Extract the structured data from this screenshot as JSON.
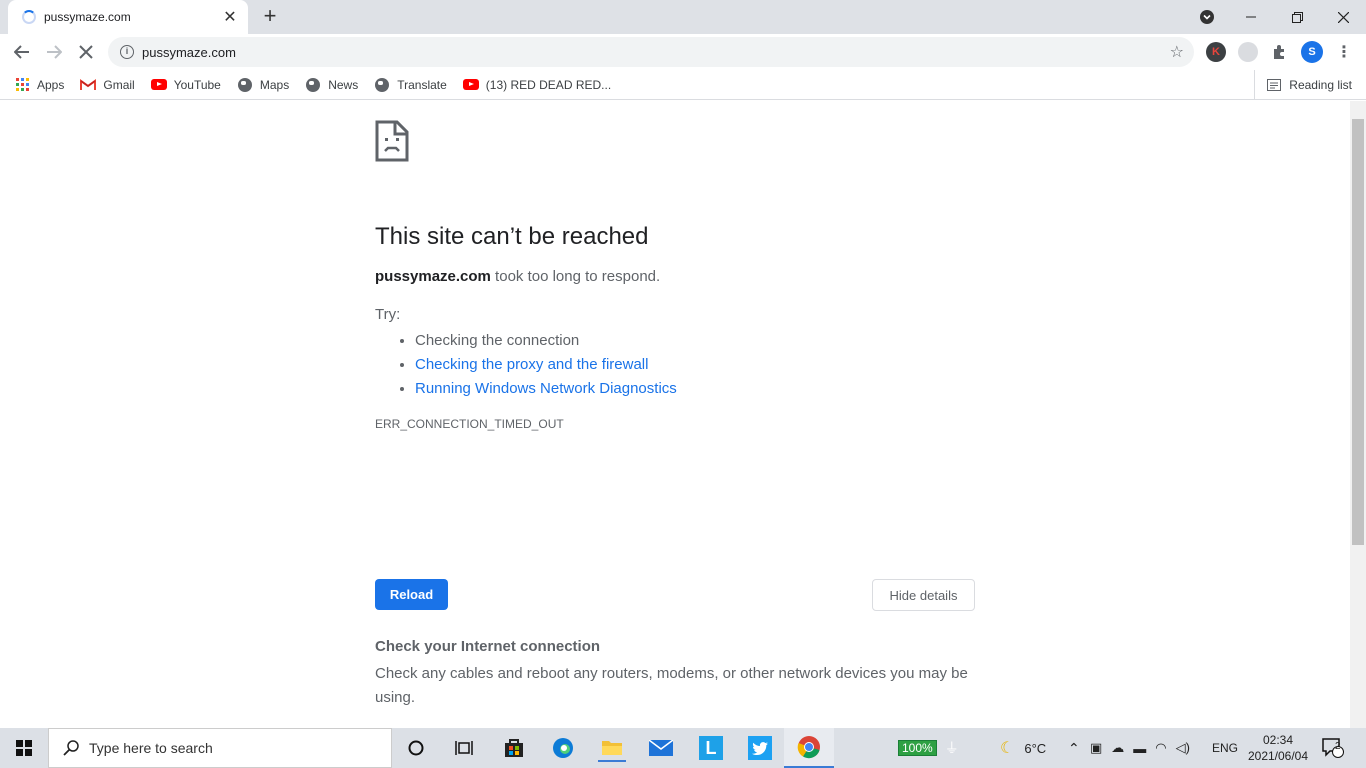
{
  "browser": {
    "tab_title": "pussymaze.com",
    "url": "pussymaze.com",
    "profile_initial": "S",
    "extension_initial": "K"
  },
  "bookmarks": [
    {
      "label": "Apps",
      "icon": "apps-grid-icon"
    },
    {
      "label": "Gmail",
      "icon": "gmail-icon"
    },
    {
      "label": "YouTube",
      "icon": "youtube-icon"
    },
    {
      "label": "Maps",
      "icon": "globe-icon"
    },
    {
      "label": "News",
      "icon": "globe-icon"
    },
    {
      "label": "Translate",
      "icon": "globe-icon"
    },
    {
      "label": "(13) RED DEAD RED...",
      "icon": "youtube-icon"
    }
  ],
  "reading_list": "Reading list",
  "error": {
    "heading": "This site can’t be reached",
    "host": "pussymaze.com",
    "message": " took too long to respond.",
    "try_label": "Try:",
    "suggestions": [
      {
        "text": "Checking the connection",
        "link": false
      },
      {
        "text": "Checking the proxy and the firewall",
        "link": true
      },
      {
        "text": "Running Windows Network Diagnostics",
        "link": true
      }
    ],
    "code": "ERR_CONNECTION_TIMED_OUT",
    "reload_label": "Reload",
    "details_label": "Hide details",
    "section_title": "Check your Internet connection",
    "section_body": "Check any cables and reboot any routers, modems, or other network devices you may be using."
  },
  "taskbar": {
    "search_placeholder": "Type here to search",
    "battery": "100%",
    "temperature": "6°C",
    "language": "ENG",
    "time": "02:34",
    "date": "2021/06/04",
    "notifications": "2"
  },
  "colors": {
    "accent": "#1a73e8",
    "tabstrip": "#dee1e6",
    "battery": "#2ea043"
  }
}
